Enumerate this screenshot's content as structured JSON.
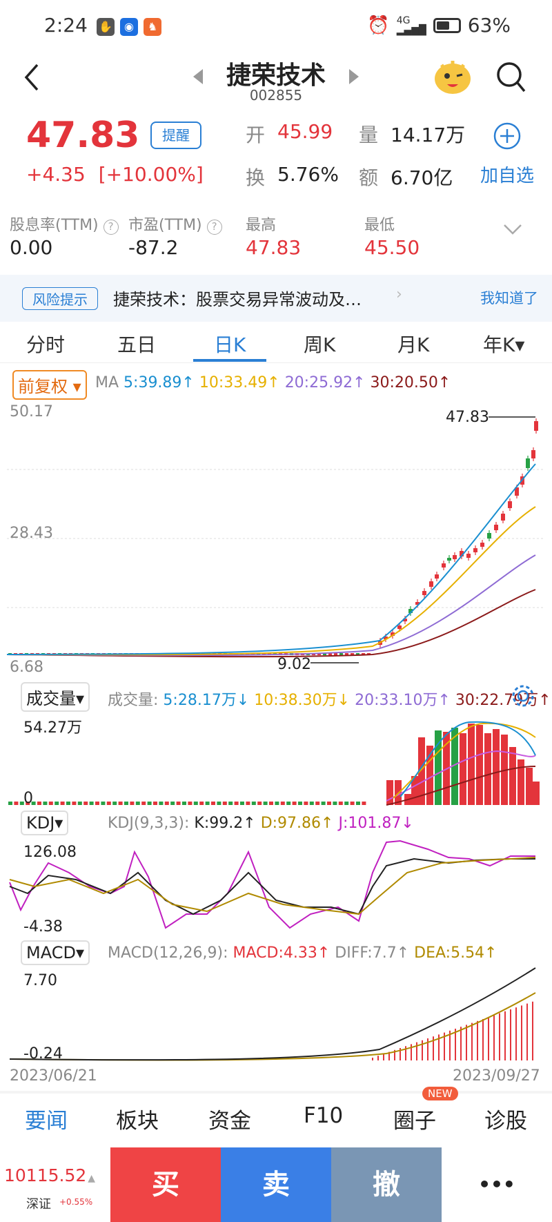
{
  "status_bar": {
    "time": "2:24",
    "battery": "63%",
    "network": "4G"
  },
  "header": {
    "title": "捷荣技术",
    "code": "002855"
  },
  "quote": {
    "price": "47.83",
    "change": "+4.35",
    "change_pct": "[+10.00%]",
    "alert_label": "提醒",
    "open_label": "开",
    "open": "45.99",
    "volume_label": "量",
    "volume": "14.17万",
    "turnover_label": "换",
    "turnover": "5.76%",
    "amount_label": "额",
    "amount": "6.70亿",
    "add_watch_label": "加自选"
  },
  "metrics": {
    "dividend_label": "股息率(TTM)",
    "dividend": "0.00",
    "pe_label": "市盈(TTM)",
    "pe": "-87.2",
    "high_label": "最高",
    "high": "47.83",
    "low_label": "最低",
    "low": "45.50"
  },
  "notice": {
    "tag": "风险提示",
    "text": "捷荣技术：股票交易异常波动及…",
    "dismiss": "我知道了"
  },
  "tabs": [
    "分时",
    "五日",
    "日K",
    "周K",
    "月K",
    "年K▾"
  ],
  "active_tab": "日K",
  "kline_panel": {
    "adjust": "前复权 ▾",
    "ma_label": "MA",
    "ma5": "5:39.89↑",
    "ma10": "10:33.49↑",
    "ma20": "20:25.92↑",
    "ma30": "30:20.50↑",
    "y_max": "50.17",
    "y_mid": "28.43",
    "y_min": "6.68",
    "max_label": "47.83",
    "min_label": "9.02"
  },
  "volume_panel": {
    "selector": "成交量▾",
    "label": "成交量:",
    "v5": "5:28.17万↓",
    "v10": "10:38.30万↓",
    "v20": "20:33.10万↑",
    "v30": "30:22.79万↑",
    "y_max": "54.27万",
    "y_min": "0"
  },
  "kdj_panel": {
    "selector": "KDJ▾",
    "label": "KDJ(9,3,3):",
    "k": "K:99.2↑",
    "d": "D:97.86↑",
    "j": "J:101.87↓",
    "y_max": "126.08",
    "y_min": "-4.38"
  },
  "macd_panel": {
    "selector": "MACD▾",
    "label": "MACD(12,26,9):",
    "macd": "MACD:4.33↑",
    "diff": "DIFF:7.7↑",
    "dea": "DEA:5.54↑",
    "y_max": "7.70",
    "y_min": "-0.24"
  },
  "dates": {
    "start": "2023/06/21",
    "end": "2023/09/27"
  },
  "bottom_nav": [
    "要闻",
    "板块",
    "资金",
    "F10",
    "圈子",
    "诊股"
  ],
  "new_badge": "NEW",
  "index": {
    "value": "10115.52",
    "arrow": "▲",
    "name": "深证",
    "change": "+0.55%"
  },
  "actions": {
    "buy": "买",
    "sell": "卖",
    "cancel": "撤",
    "more": "•••"
  },
  "colors": {
    "up": "#e3343b",
    "down": "#27a145",
    "ma5": "#1a8fd0",
    "ma10": "#e6b000",
    "ma20": "#8e6bd4",
    "ma30": "#8b1a1a",
    "accent": "#2a7fd4"
  }
}
